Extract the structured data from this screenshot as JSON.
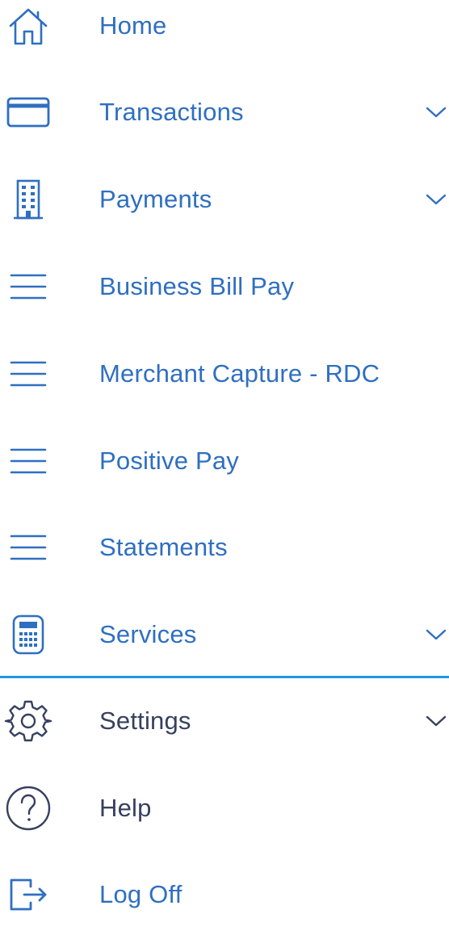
{
  "colors": {
    "primary": "#2f6fc1",
    "secondary": "#37405f",
    "divider": "#1f97dd"
  },
  "nav": {
    "items": [
      {
        "label": "Home",
        "icon": "home-icon",
        "has_submenu": false
      },
      {
        "label": "Transactions",
        "icon": "credit-card-icon",
        "has_submenu": true
      },
      {
        "label": "Payments",
        "icon": "building-icon",
        "has_submenu": true
      },
      {
        "label": "Business Bill Pay",
        "icon": "menu-lines-icon",
        "has_submenu": false
      },
      {
        "label": "Merchant Capture - RDC",
        "icon": "menu-lines-icon",
        "has_submenu": false
      },
      {
        "label": "Positive Pay",
        "icon": "menu-lines-icon",
        "has_submenu": false
      },
      {
        "label": "Statements",
        "icon": "menu-lines-icon",
        "has_submenu": false
      },
      {
        "label": "Services",
        "icon": "calculator-icon",
        "has_submenu": true
      }
    ],
    "footer": [
      {
        "label": "Settings",
        "icon": "gear-icon",
        "has_submenu": true
      },
      {
        "label": "Help",
        "icon": "question-icon",
        "has_submenu": false
      },
      {
        "label": "Log Off",
        "icon": "logout-icon",
        "has_submenu": false
      }
    ]
  }
}
